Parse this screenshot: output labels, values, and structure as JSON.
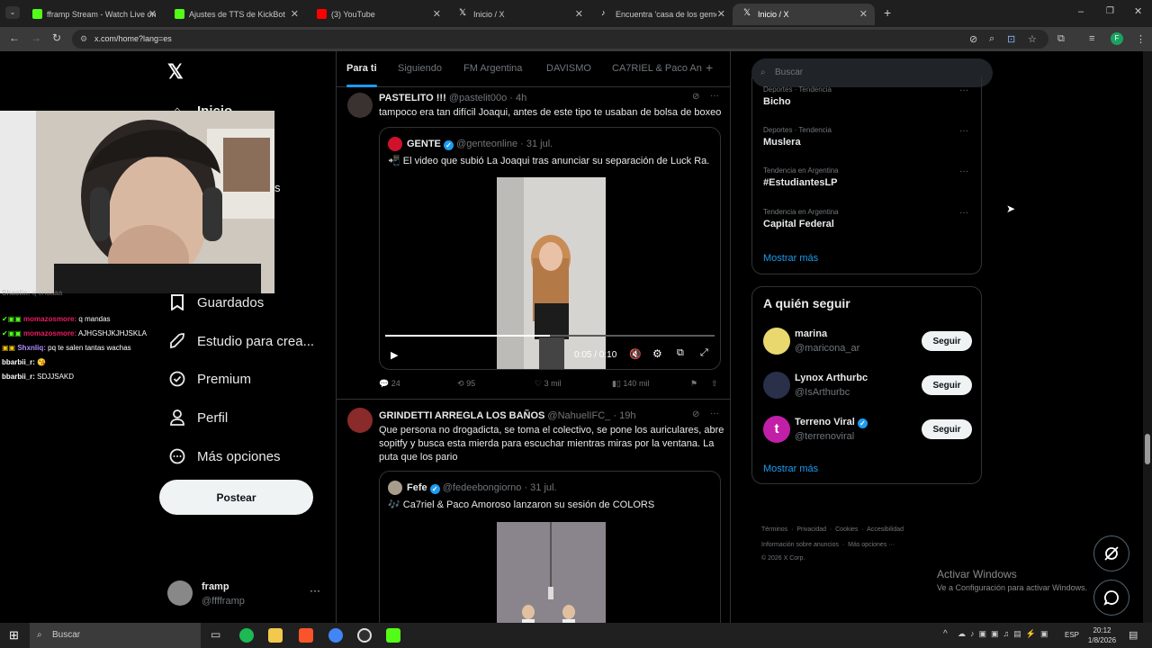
{
  "browser": {
    "tabs": [
      {
        "title": "fframp Stream - Watch Live on",
        "color": "#53fc18"
      },
      {
        "title": "Ajustes de TTS de KickBot",
        "color": "#53fc18"
      },
      {
        "title": "(3) YouTube",
        "color": "#ff0000"
      },
      {
        "title": "Inicio / X",
        "color": "#ffffff"
      },
      {
        "title": "Encuentra 'casa de los gemelos",
        "color": "#ffffff"
      },
      {
        "title": "Inicio / X",
        "color": "#ffffff"
      }
    ],
    "url": "x.com/home?lang=es"
  },
  "sidebar": {
    "items": [
      {
        "label": "Inicio",
        "icon": "home-icon"
      },
      {
        "label": "Guardados",
        "icon": "bookmark-icon"
      },
      {
        "label": "Estudio para crea...",
        "icon": "rocket-icon"
      },
      {
        "label": "Premium",
        "icon": "verified-badge-icon"
      },
      {
        "label": "Perfil",
        "icon": "person-icon"
      },
      {
        "label": "Más opciones",
        "icon": "more-circle-icon"
      }
    ],
    "partial_label": "s",
    "post_label": "Postear",
    "account": {
      "name": "framp",
      "handle": "@fffframp"
    }
  },
  "chat": [
    {
      "user": "Shaolin:",
      "msg": "q ondaaa",
      "color": "#9b59b6"
    },
    {
      "user": "momazosmore:",
      "msg": "q mandas",
      "color": "#e91e63"
    },
    {
      "user": "momazosmore:",
      "msg": "AJHGSHJKJHJSKLA",
      "color": "#e91e63"
    },
    {
      "user": "Shxnliq:",
      "msg": "pq te salen tantas wachas",
      "color": "#9b59b6"
    },
    {
      "user": "bbarbii_r:",
      "msg": "😘",
      "color": "#ffffff"
    },
    {
      "user": "bbarbii_r:",
      "msg": "SDJJSAKD",
      "color": "#ffffff"
    }
  ],
  "feed_tabs": [
    "Para ti",
    "Siguiendo",
    "FM Argentina",
    "DAVISMO",
    "CA7RIEL & Paco An"
  ],
  "tweets": [
    {
      "name": "PASTELITO !!!",
      "handle": "@pastelit00o",
      "time": "· 4h",
      "text": "tampoco era tan difícil Joaqui, antes de este tipo te usaban de bolsa de boxeo",
      "quote": {
        "name": "GENTE",
        "handle": "@genteonline",
        "time": "· 31 jul.",
        "text": "📲 El video que subió La Joaqui tras anunciar su separación de Luck Ra.",
        "video_time": "0:05 / 0:10",
        "video_progress": 0.5
      },
      "actions": {
        "replies": "24",
        "reposts": "95",
        "likes": "3 mil",
        "views": "140 mil"
      }
    },
    {
      "name": "GRINDETTI ARREGLA LOS BAÑOS",
      "handle": "@NahuelIFC_",
      "time": "· 19h",
      "text": "Que persona no drogadicta, se toma el colectivo, se pone los auriculares, abre sopitfy y busca esta mierda para escuchar mientras miras por la ventana. La puta que los pario",
      "quote": {
        "name": "Fefe",
        "handle": "@fedeebongiorno",
        "time": "· 31 jul.",
        "text": "🎶 Ca7riel & Paco Amoroso lanzaron su sesión de COLORS"
      }
    }
  ],
  "right": {
    "search_placeholder": "Buscar",
    "trends": [
      {
        "category": "Deportes · Tendencia",
        "title": "Bicho"
      },
      {
        "category": "Deportes · Tendencia",
        "title": "Muslera"
      },
      {
        "category": "Tendencia en Argentina",
        "title": "#EstudiantesLP"
      },
      {
        "category": "Tendencia en Argentina",
        "title": "Capital Federal"
      }
    ],
    "show_more": "Mostrar más",
    "who_to_follow_title": "A quién seguir",
    "follow": [
      {
        "name": "marina",
        "handle": "@maricona_ar",
        "button": "Seguir",
        "verified": false
      },
      {
        "name": "Lynox Arthurbc",
        "handle": "@IsArthurbc",
        "button": "Seguir",
        "verified": false
      },
      {
        "name": "Terreno Viral",
        "handle": "@terrenoviral",
        "button": "Seguir",
        "verified": true
      }
    ],
    "show_more_2": "Mostrar más",
    "footer": {
      "line1": [
        "Términos",
        "Privacidad",
        "Cookies",
        "Accesibilidad"
      ],
      "line2": [
        "Información sobre anuncios",
        "Más opciones ···"
      ],
      "copyright": "© 2026 X Corp."
    }
  },
  "watermark": {
    "title": "Activar Windows",
    "subtitle": "Ve a Configuración para activar Windows."
  },
  "taskbar": {
    "search": "Buscar",
    "lang": "ESP",
    "time": "20:12",
    "date": "1/8/2026"
  }
}
